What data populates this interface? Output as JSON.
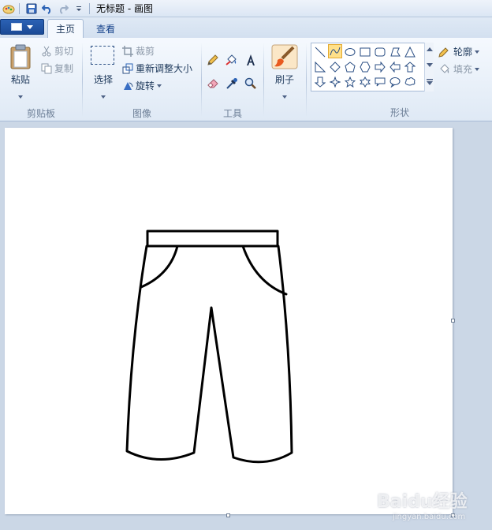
{
  "window": {
    "title": "无标题 - 画图"
  },
  "tabs": [
    {
      "label": "主页",
      "active": true
    },
    {
      "label": "查看",
      "active": false
    }
  ],
  "clipboard": {
    "paste_label": "粘贴",
    "cut_label": "剪切",
    "copy_label": "复制",
    "group_label": "剪贴板"
  },
  "image": {
    "select_label": "选择",
    "crop_label": "裁剪",
    "resize_label": "重新调整大小",
    "rotate_label": "旋转",
    "group_label": "图像"
  },
  "tools": {
    "group_label": "工具",
    "items": [
      "pencil-icon",
      "fill-icon",
      "text-icon",
      "eraser-icon",
      "color-picker-icon",
      "magnifier-icon"
    ]
  },
  "brushes": {
    "label": "刷子"
  },
  "shapes": {
    "group_label": "形状",
    "outline_label": "轮廓",
    "fill_label": "填充"
  },
  "watermark": {
    "top": "Baidu经验",
    "bottom": "jingyan.baidu.com"
  },
  "colors": {
    "accent": "#1b4a96",
    "ribbon_bg": "#f5f9fe",
    "workspace": "#cbd7e6",
    "selection": "#ffe08a"
  }
}
